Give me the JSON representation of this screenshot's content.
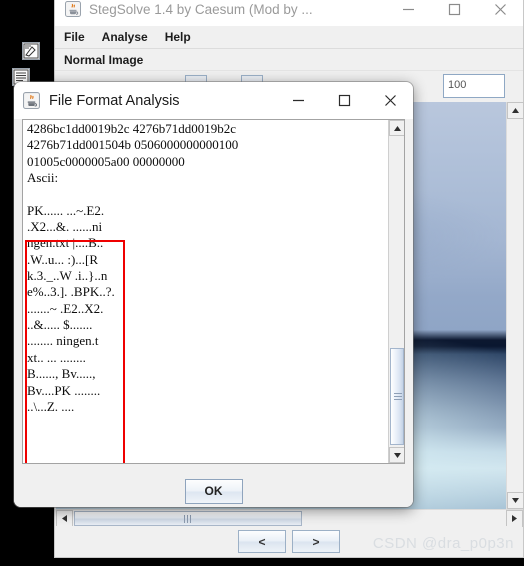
{
  "desktop": {
    "icons": [
      {
        "name": "desktop-icon-editor"
      },
      {
        "name": "desktop-icon-document"
      }
    ]
  },
  "stegsolve": {
    "title": "StegSolve 1.4 by Caesum (Mod by ...",
    "app_icon": "java-coffee-cup-icon",
    "window_controls": {
      "minimize": "minimize-icon",
      "maximize": "maximize-icon",
      "close": "close-icon"
    },
    "menu": [
      {
        "label": "File"
      },
      {
        "label": "Analyse"
      },
      {
        "label": "Help"
      }
    ],
    "mode_label": "Normal Image",
    "toolbar": {
      "zoom_value": "100"
    },
    "nav": {
      "prev_label": "<",
      "next_label": ">"
    },
    "scrollbars": {
      "v_up": "scroll-up-arrow-icon",
      "v_down": "scroll-down-arrow-icon",
      "h_left": "scroll-left-arrow-icon",
      "h_right": "scroll-right-arrow-icon"
    }
  },
  "dialog": {
    "title": "File Format Analysis",
    "app_icon": "java-coffee-cup-icon",
    "window_controls": {
      "minimize": "minimize-icon",
      "maximize": "maximize-icon",
      "close": "close-icon"
    },
    "content": "4286bc1dd0019b2c 4276b71dd0019b2c\n4276b71dd001504b 0506000000000100\n01005c0000005a00 00000000\nAscii:\n\nPK...... ...~.E2.\n.X2...&. ......ni\nngen.txt |....B..\n.W..u... :)...[R\nk.3._..W .i..}..n\ne%..3.]. .BPK..?.\n.......~ .E2..X2.\n..&..... $.......\n........ ningen.t\nxt.. ... ........\nB......, Bv.....,\nBv....PK ........\n..\\...Z. ....",
    "ok_label": "OK",
    "highlight_color": "#ef0000",
    "scrollbar": {
      "up": "scroll-up-arrow-icon",
      "down": "scroll-down-arrow-icon"
    }
  },
  "watermark": {
    "text": "CSDN @dra_p0p3n"
  }
}
